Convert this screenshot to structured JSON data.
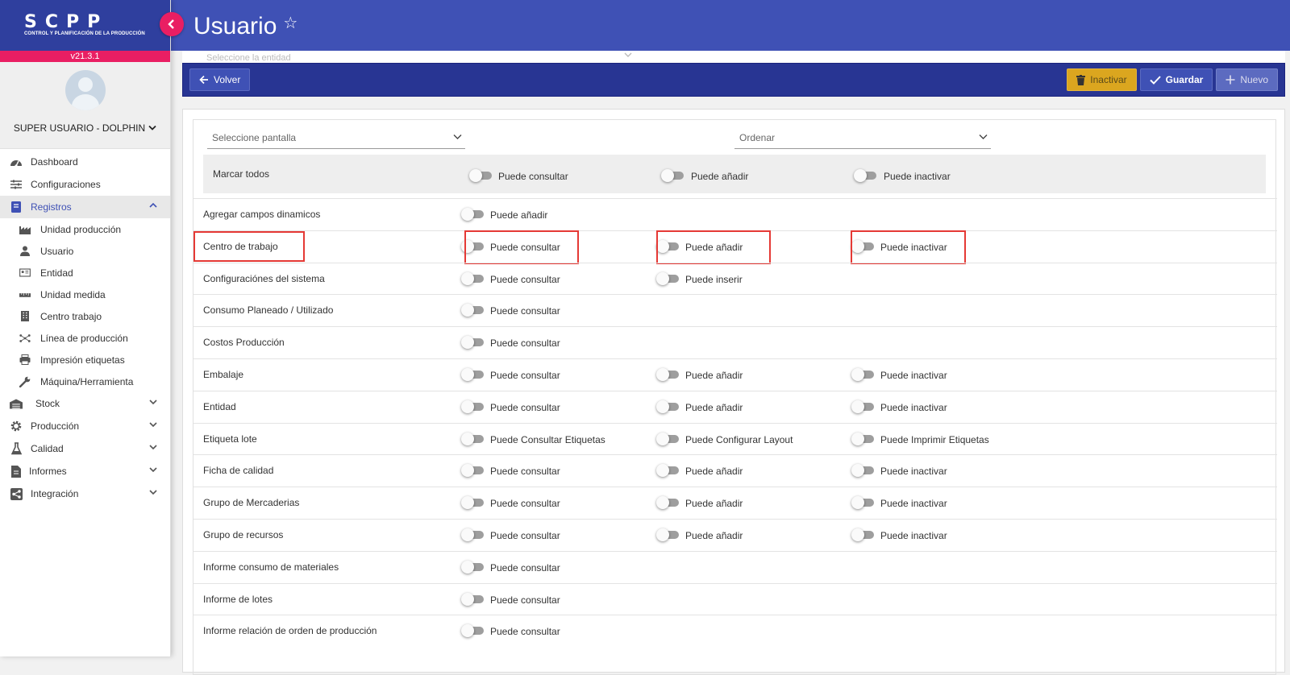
{
  "brand": {
    "name": "SCPP",
    "subtitle": "CONTROL Y PLANIFICACIÓN DE LA PRODUCCIÓN",
    "version": "v21.3.1"
  },
  "user": {
    "name": "SUPER USUARIO - DOLPHIN"
  },
  "nav": {
    "items": [
      {
        "label": "Dashboard",
        "icon": "dashboard-icon"
      },
      {
        "label": "Configuraciones",
        "icon": "sliders-icon"
      },
      {
        "label": "Registros",
        "icon": "book-icon",
        "active": true,
        "expanded": true
      }
    ],
    "sub_items": [
      {
        "label": "Unidad producción",
        "icon": "factory-icon"
      },
      {
        "label": "Usuario",
        "icon": "person-icon"
      },
      {
        "label": "Entidad",
        "icon": "id-card-icon"
      },
      {
        "label": "Unidad medida",
        "icon": "ruler-icon"
      },
      {
        "label": "Centro trabajo",
        "icon": "building-icon"
      },
      {
        "label": "Línea de producción",
        "icon": "network-icon"
      },
      {
        "label": "Impresión etiquetas",
        "icon": "printer-icon"
      },
      {
        "label": "Máquina/Herramienta",
        "icon": "wrench-icon"
      }
    ],
    "collapsed_items": [
      {
        "label": "Stock",
        "icon": "warehouse-icon"
      },
      {
        "label": "Producción",
        "icon": "gear-icon"
      },
      {
        "label": "Calidad",
        "icon": "flask-icon"
      },
      {
        "label": "Informes",
        "icon": "document-icon"
      },
      {
        "label": "Integración",
        "icon": "share-icon"
      }
    ]
  },
  "header": {
    "title": "Usuario"
  },
  "faded_select": {
    "placeholder": "Seleccione la entidad"
  },
  "toolbar": {
    "back_label": "Volver",
    "inactivate_label": "Inactivar",
    "save_label": "Guardar",
    "new_label": "Nuevo"
  },
  "filters": {
    "screen_placeholder": "Seleccione pantalla",
    "order_placeholder": "Ordenar"
  },
  "mark_all": {
    "label": "Marcar todos",
    "perms": [
      "Puede consultar",
      "Puede añadir",
      "Puede inactivar"
    ]
  },
  "permissions": [
    {
      "name": "Agregar campos dinamicos",
      "perms": [
        "Puede añadir"
      ]
    },
    {
      "name": "Centro de trabajo",
      "perms": [
        "Puede consultar",
        "Puede añadir",
        "Puede inactivar"
      ],
      "highlighted": true
    },
    {
      "name": "Configuraciónes del sistema",
      "perms": [
        "Puede consultar",
        "Puede inserir"
      ]
    },
    {
      "name": "Consumo Planeado / Utilizado",
      "perms": [
        "Puede consultar"
      ]
    },
    {
      "name": "Costos Producción",
      "perms": [
        "Puede consultar"
      ]
    },
    {
      "name": "Embalaje",
      "perms": [
        "Puede consultar",
        "Puede añadir",
        "Puede inactivar"
      ]
    },
    {
      "name": "Entidad",
      "perms": [
        "Puede consultar",
        "Puede añadir",
        "Puede inactivar"
      ]
    },
    {
      "name": "Etiqueta lote",
      "perms": [
        "Puede Consultar Etiquetas",
        "Puede Configurar Layout",
        "Puede Imprimir Etiquetas"
      ]
    },
    {
      "name": "Ficha de calidad",
      "perms": [
        "Puede consultar",
        "Puede añadir",
        "Puede inactivar"
      ]
    },
    {
      "name": "Grupo de Mercaderias",
      "perms": [
        "Puede consultar",
        "Puede añadir",
        "Puede inactivar"
      ]
    },
    {
      "name": "Grupo de recursos",
      "perms": [
        "Puede consultar",
        "Puede añadir",
        "Puede inactivar"
      ]
    },
    {
      "name": "Informe consumo de materiales",
      "perms": [
        "Puede consultar"
      ]
    },
    {
      "name": "Informe de lotes",
      "perms": [
        "Puede consultar"
      ]
    },
    {
      "name": "Informe relación de orden de producción",
      "perms": [
        "Puede consultar"
      ]
    }
  ]
}
